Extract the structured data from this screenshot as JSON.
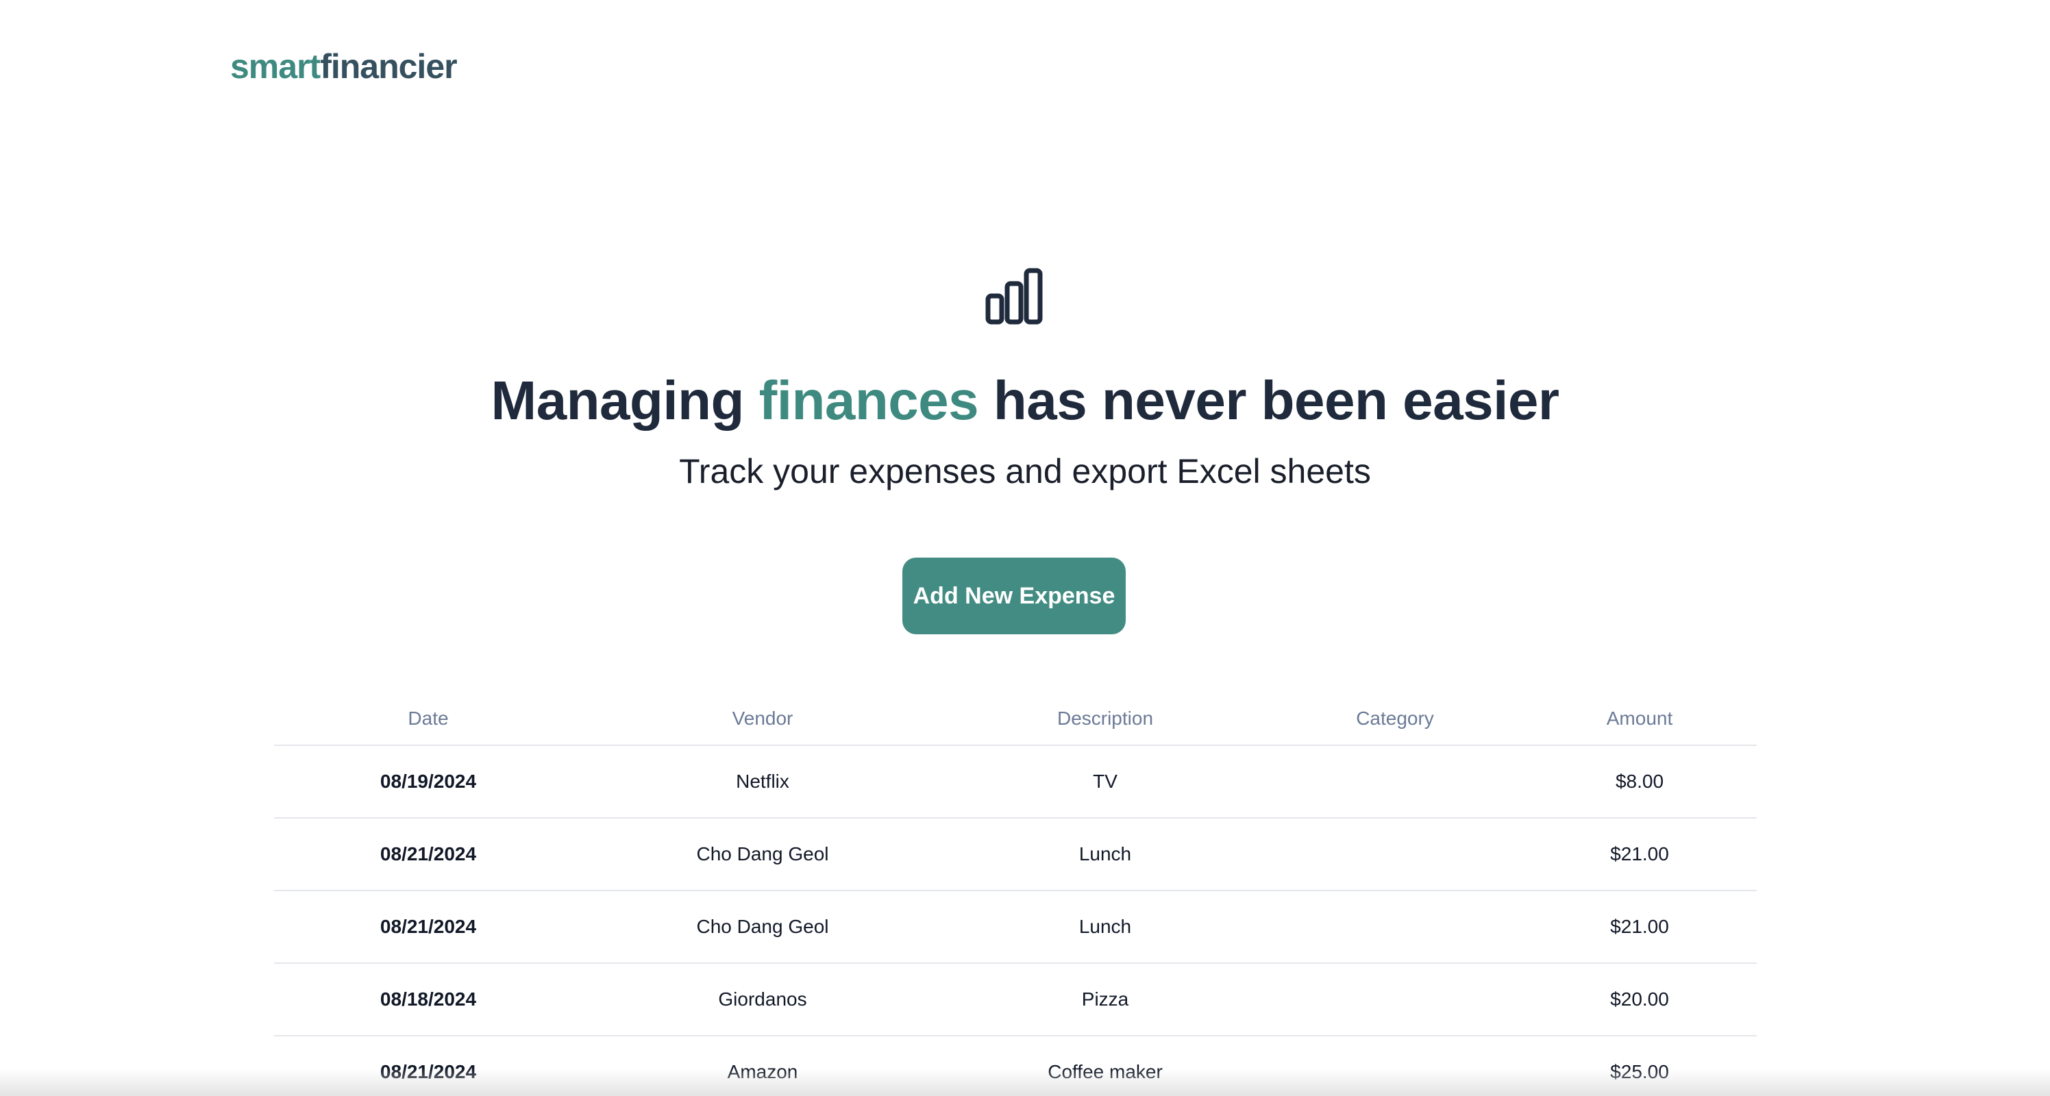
{
  "brand": {
    "part1": "smart",
    "part2": "financier"
  },
  "hero": {
    "icon": "bar-chart-icon",
    "headline_pre": "Managing ",
    "headline_accent": "finances",
    "headline_post": " has never been easier",
    "subhead": "Track your expenses and export Excel sheets"
  },
  "actions": {
    "add_label": "Add New Expense"
  },
  "table": {
    "headers": {
      "date": "Date",
      "vendor": "Vendor",
      "description": "Description",
      "category": "Category",
      "amount": "Amount"
    },
    "rows": [
      {
        "date": "08/19/2024",
        "vendor": "Netflix",
        "description": "TV",
        "category": "",
        "amount": "$8.00"
      },
      {
        "date": "08/21/2024",
        "vendor": "Cho Dang Geol",
        "description": "Lunch",
        "category": "",
        "amount": "$21.00"
      },
      {
        "date": "08/21/2024",
        "vendor": "Cho Dang Geol",
        "description": "Lunch",
        "category": "",
        "amount": "$21.00"
      },
      {
        "date": "08/18/2024",
        "vendor": "Giordanos",
        "description": "Pizza",
        "category": "",
        "amount": "$20.00"
      },
      {
        "date": "08/21/2024",
        "vendor": "Amazon",
        "description": "Coffee maker",
        "category": "",
        "amount": "$25.00"
      }
    ]
  },
  "colors": {
    "accent": "#438c83",
    "brand_dark": "#35505e",
    "heading": "#1f2a3c",
    "header_text": "#6b7a96"
  }
}
